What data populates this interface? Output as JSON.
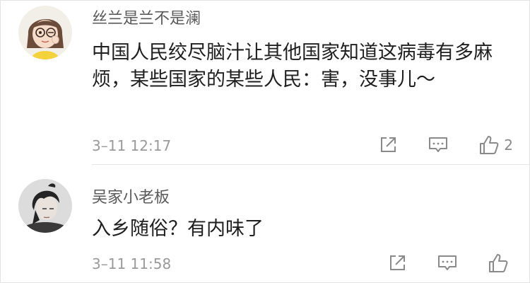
{
  "comments": [
    {
      "username": "丝兰是兰不是澜",
      "text": "中国人民绞尽脑汁让其他国家知道这病毒有多麻烦，某些国家的某些人民：害，没事儿～",
      "time": "3–11 12:17",
      "likes": "2",
      "avatar_icon": "cartoon-girl-avatar-icon"
    },
    {
      "username": "吴家小老板",
      "text": "入乡随俗？有内味了",
      "time": "3–11 11:58",
      "likes": "",
      "avatar_icon": "anime-character-avatar-icon"
    }
  ],
  "icons": {
    "share": "share-icon",
    "comment": "comment-icon",
    "like": "thumbs-up-icon"
  },
  "colors": {
    "text": "#1f1f1f",
    "username": "#5a5a5a",
    "meta": "#9a9a9a",
    "icon": "#8a8a8a"
  }
}
